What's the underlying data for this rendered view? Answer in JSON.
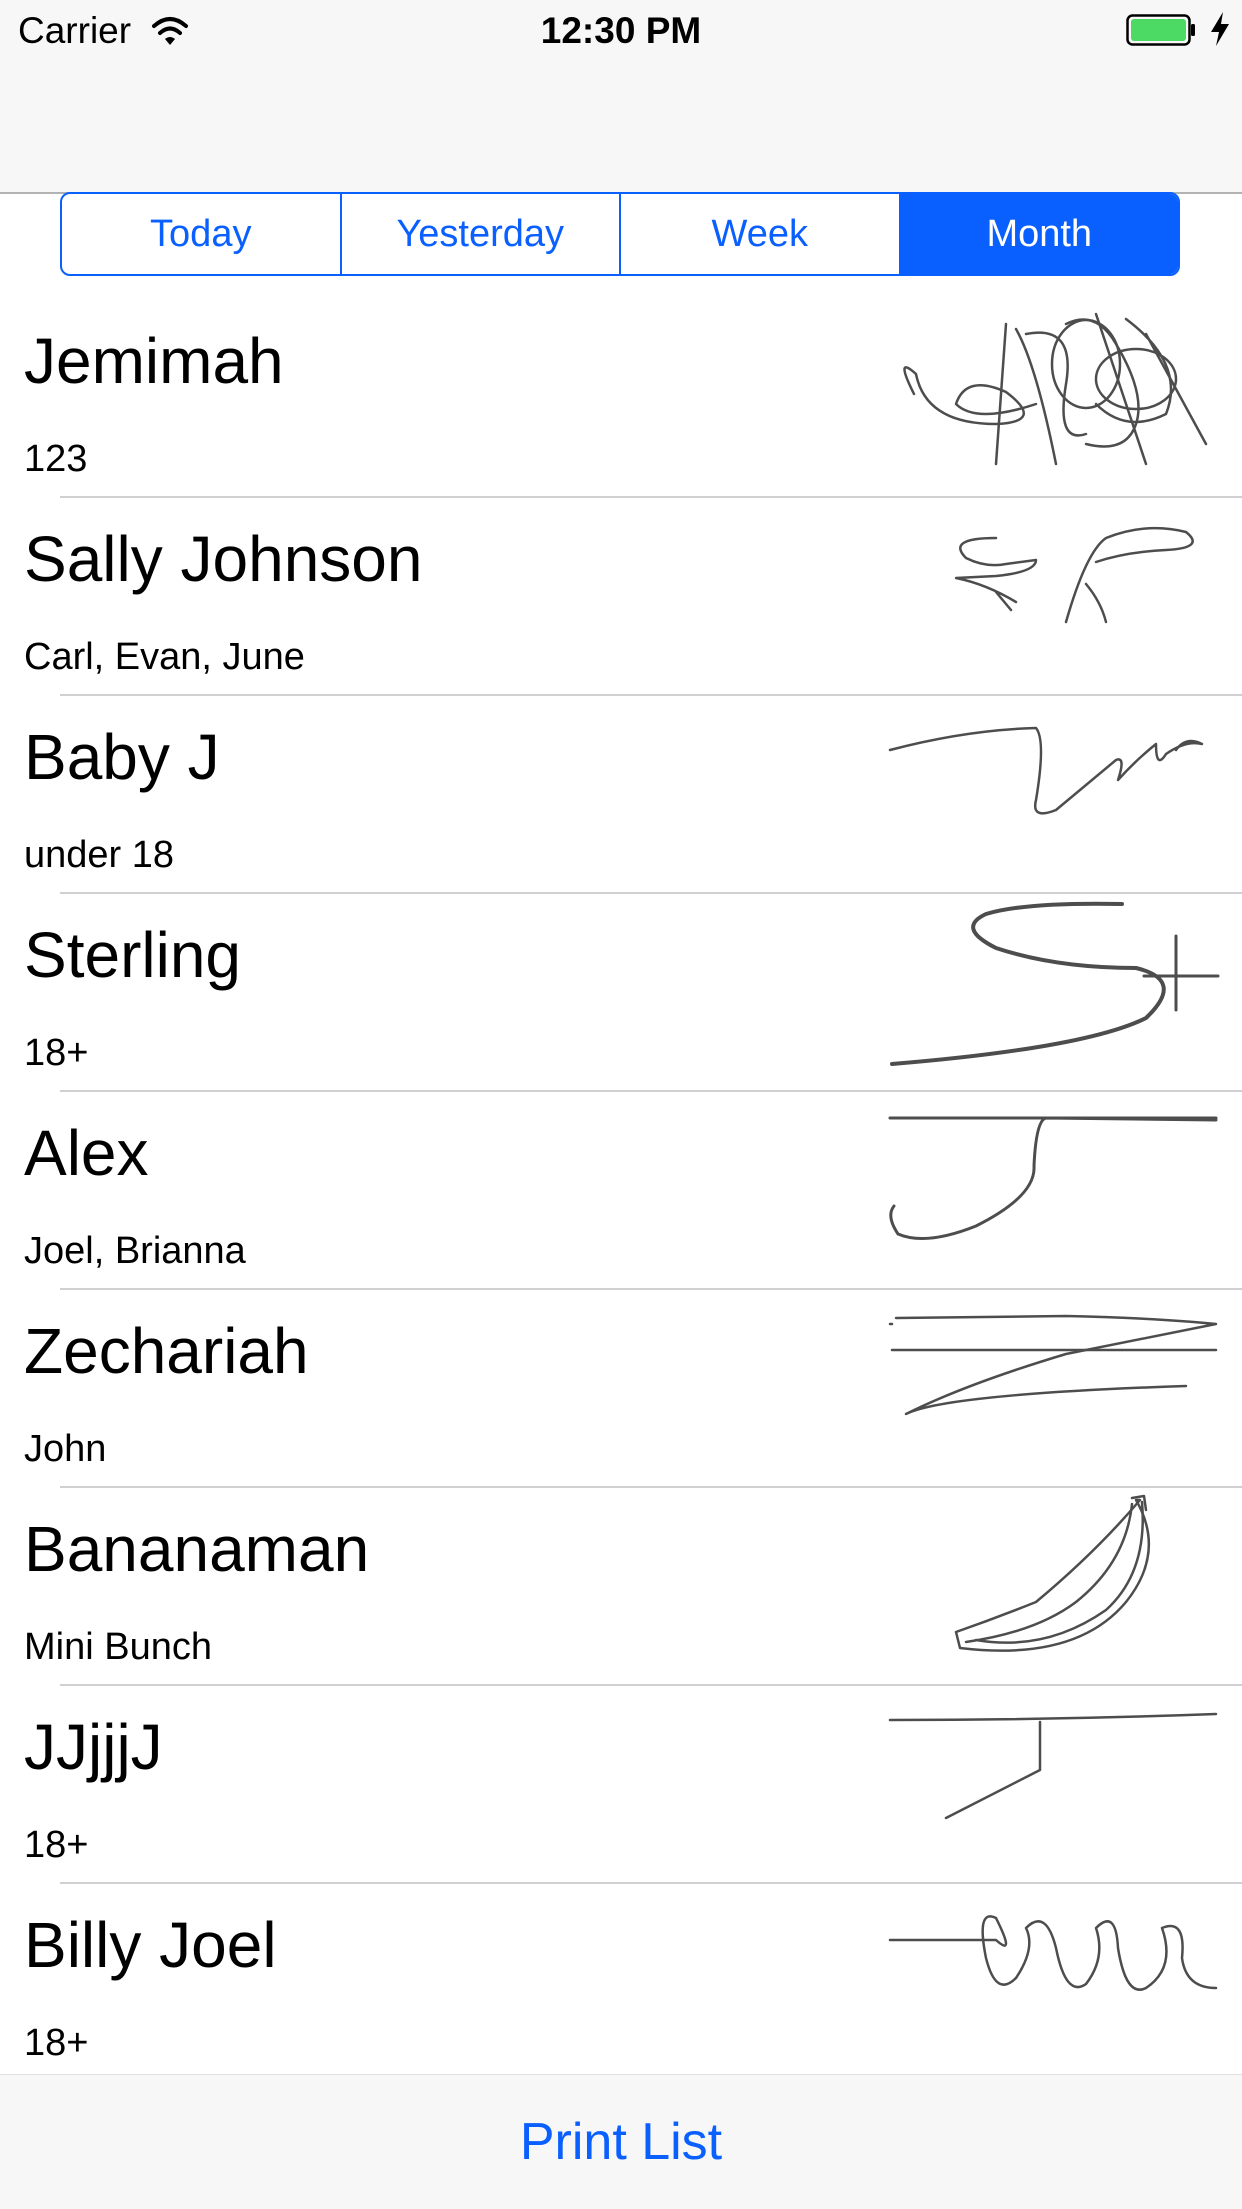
{
  "status_bar": {
    "carrier": "Carrier",
    "time": "12:30 PM",
    "wifi_icon": "wifi-icon",
    "battery_icon": "battery-icon",
    "charging_icon": "charging-bolt-icon",
    "battery_level": 1.0,
    "battery_color": "#4cd964"
  },
  "segmented_control": {
    "segments": [
      "Today",
      "Yesterday",
      "Week",
      "Month"
    ],
    "selected": "Month",
    "accent_color": "#0a60ff"
  },
  "list": {
    "rows": [
      {
        "name": "Jemimah",
        "detail": "123"
      },
      {
        "name": "Sally Johnson",
        "detail": "Carl, Evan, June"
      },
      {
        "name": "Baby J",
        "detail": "under 18"
      },
      {
        "name": "Sterling",
        "detail": "18+"
      },
      {
        "name": "Alex",
        "detail": "Joel, Brianna"
      },
      {
        "name": "Zechariah",
        "detail": "John"
      },
      {
        "name": "Bananaman",
        "detail": "Mini Bunch"
      },
      {
        "name": "JJjjjJ",
        "detail": "18+"
      },
      {
        "name": "Billy Joel",
        "detail": "18+"
      }
    ]
  },
  "toolbar": {
    "print_label": "Print List"
  }
}
